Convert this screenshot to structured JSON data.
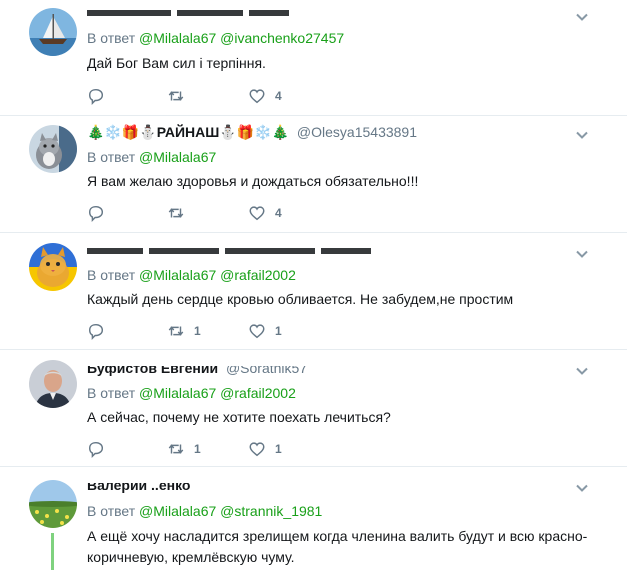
{
  "tweets": [
    {
      "name": "",
      "handle": "",
      "reply_prefix": "В ответ",
      "mentions": [
        "@Milalala67",
        "@ivanchenko27457"
      ],
      "text": "Дай  Бог Вам сил і терпіння.",
      "reply_count": "",
      "retweet_count": "",
      "like_count": "4"
    },
    {
      "name": "🎄❄️🎁⛄РАЙНАШ⛄🎁❄️🎄",
      "handle": "@Olesya15433891",
      "reply_prefix": "В ответ",
      "mentions": [
        "@Milalala67"
      ],
      "text": "Я вам желаю здоровья и дождаться обязательно!!!",
      "reply_count": "",
      "retweet_count": "",
      "like_count": "4"
    },
    {
      "name": "",
      "handle": "",
      "reply_prefix": "В ответ",
      "mentions": [
        "@Milalala67",
        "@rafail2002"
      ],
      "text": "Каждый день сердце кровью обливается. Не забудем,не простим",
      "reply_count": "",
      "retweet_count": "1",
      "like_count": "1"
    },
    {
      "name": "Буфистов Евгений",
      "handle": "@Soratnik57",
      "reply_prefix": "В ответ",
      "mentions": [
        "@Milalala67",
        "@rafail2002"
      ],
      "text": "А сейчас, почему не хотите поехать лечиться?",
      "reply_count": "",
      "retweet_count": "1",
      "like_count": "1"
    },
    {
      "name": "Валерий ..енко",
      "handle": "",
      "reply_prefix": "В ответ",
      "mentions": [
        "@Milalala67",
        "@strannik_1981"
      ],
      "text": "А ещё хочу насладится зрелищем когда членина валить будут и всю красно-коричневую, кремлёвскую чуму.",
      "reply_count": "",
      "retweet_count": "",
      "like_count": ""
    }
  ],
  "icons": {
    "reply": "reply-icon",
    "retweet": "retweet-icon",
    "like": "heart-icon",
    "more": "chevron-down-icon"
  },
  "colors": {
    "mention": "#19a019",
    "secondary_text": "#657786",
    "divider": "#e6ecf0",
    "thread_line": "#7fd27f"
  }
}
